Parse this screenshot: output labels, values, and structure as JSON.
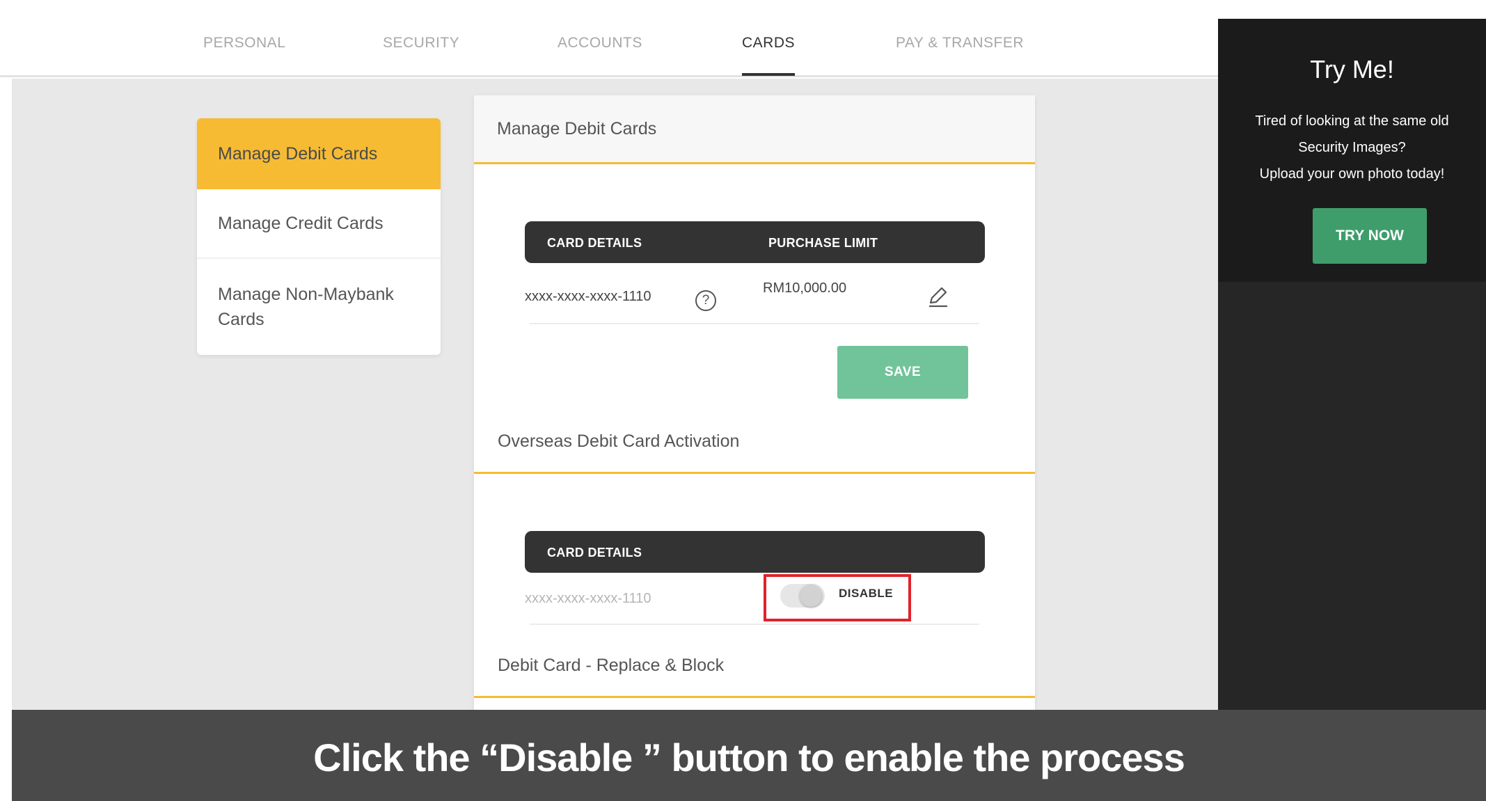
{
  "nav": {
    "tabs": [
      {
        "label": "PERSONAL",
        "active": false
      },
      {
        "label": "SECURITY",
        "active": false
      },
      {
        "label": "ACCOUNTS",
        "active": false
      },
      {
        "label": "CARDS",
        "active": true
      },
      {
        "label": "PAY & TRANSFER",
        "active": false
      }
    ]
  },
  "sidebar": {
    "items": [
      {
        "label": "Manage Debit Cards",
        "selected": true
      },
      {
        "label": "Manage Credit Cards",
        "selected": false
      },
      {
        "label": "Manage Non-Maybank Cards",
        "selected": false
      }
    ]
  },
  "main": {
    "header_title": "Manage Debit Cards",
    "limit_table": {
      "col_card": "CARD DETAILS",
      "col_limit": "PURCHASE LIMIT",
      "card_number": "xxxx-xxxx-xxxx-1110",
      "help_glyph": "?",
      "limit_value": "RM10,000.00",
      "save_label": "SAVE"
    },
    "overseas_title": "Overseas Debit Card Activation",
    "overseas_table": {
      "col_card": "CARD DETAILS",
      "card_number": "xxxx-xxxx-xxxx-1110",
      "toggle_label": "DISABLE"
    },
    "replace_title": "Debit Card - Replace & Block"
  },
  "promo": {
    "title": "Try Me!",
    "lines": [
      "Tired of looking at the same old",
      "Security Images?",
      "Upload your own photo today!"
    ],
    "button_label": "TRY NOW"
  },
  "caption": "Click the “Disable ” button to enable the process",
  "colors": {
    "accent_yellow": "#f6bb33",
    "save_green": "#71c39a",
    "promo_green": "#3f9d6c",
    "highlight_red": "#e0232b",
    "dark_header": "#333333"
  }
}
